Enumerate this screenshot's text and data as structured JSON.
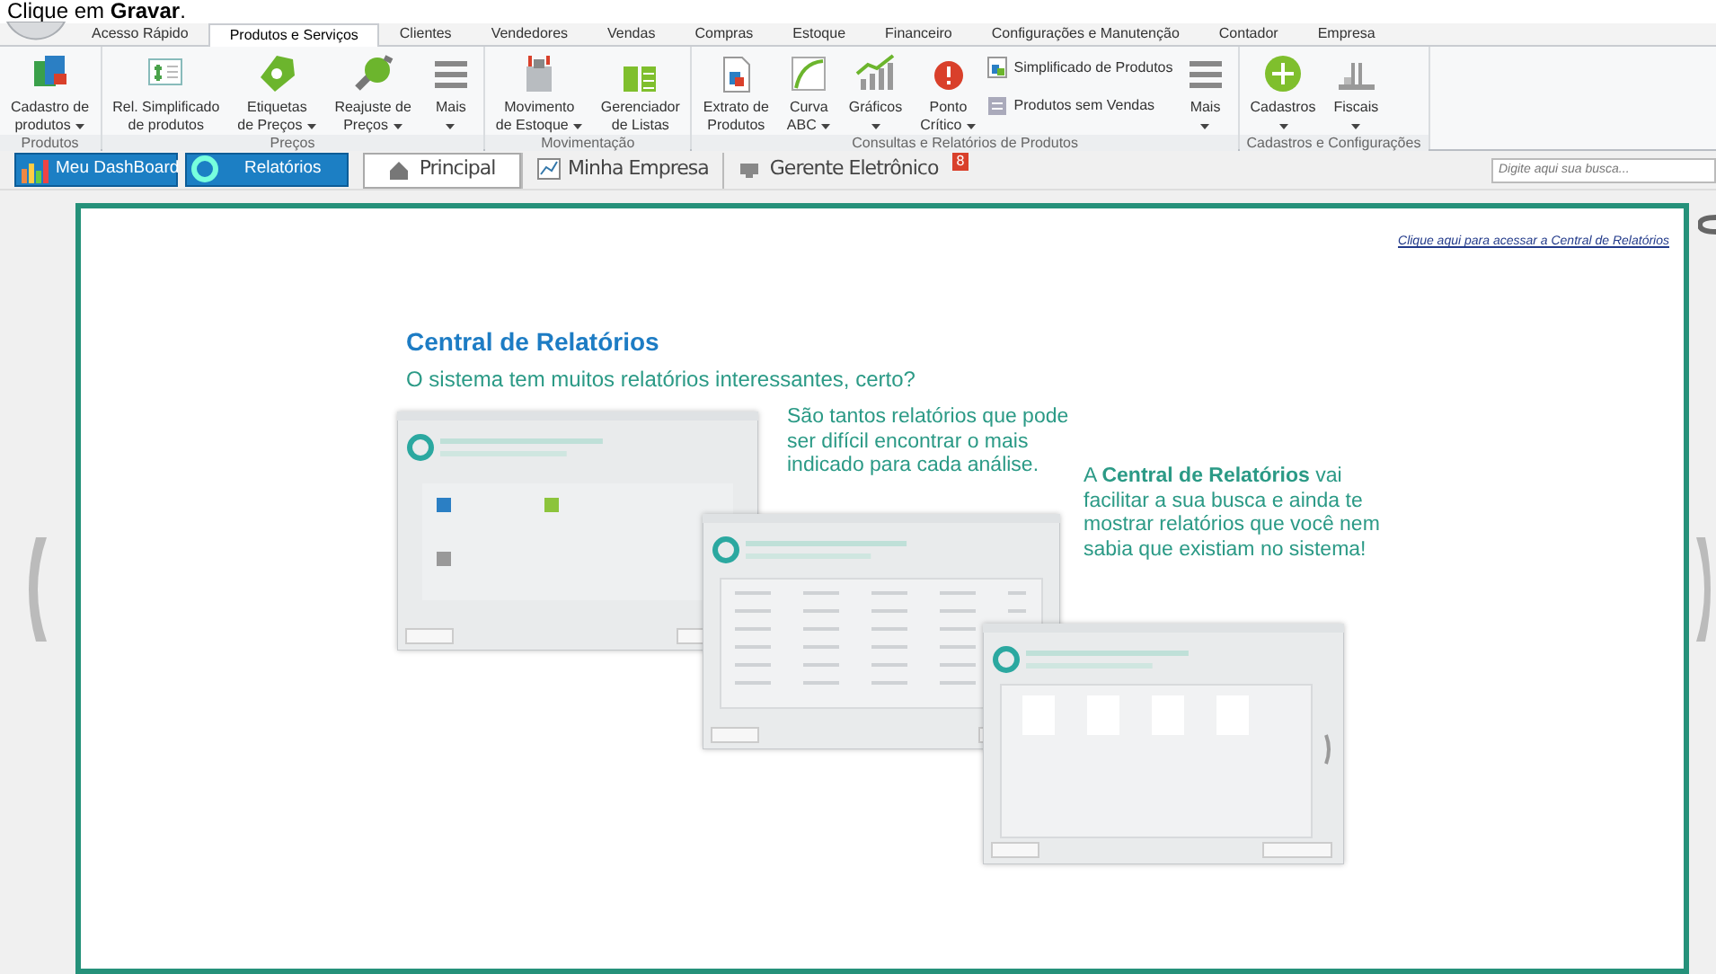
{
  "caption": "Clique em **Gravar**.",
  "menu_tabs": [
    {
      "label": "Acesso Rápido",
      "selected": false
    },
    {
      "label": "Produtos e Serviços",
      "selected": true
    },
    {
      "label": "Clientes",
      "selected": false
    },
    {
      "label": "Vendedores",
      "selected": false
    },
    {
      "label": "Vendas",
      "selected": false
    },
    {
      "label": "Compras",
      "selected": false
    },
    {
      "label": "Estoque",
      "selected": false
    },
    {
      "label": "Financeiro",
      "selected": false
    },
    {
      "label": "Configurações e Manutenção",
      "selected": false
    },
    {
      "label": "Contador",
      "selected": false
    },
    {
      "label": "Empresa",
      "selected": false
    }
  ],
  "ribbon_groups": [
    {
      "label": "Produtos",
      "items": [
        {
          "kind": "large",
          "lines": [
            "Cadastro de",
            "produtos"
          ],
          "dropdown": true
        }
      ]
    },
    {
      "label": "Preços",
      "items": [
        {
          "kind": "large",
          "lines": [
            "Rel. Simplificado",
            "de produtos"
          ],
          "dropdown": false
        },
        {
          "kind": "large",
          "lines": [
            "Etiquetas",
            "de Preços"
          ],
          "dropdown": true
        },
        {
          "kind": "large",
          "lines": [
            "Reajuste de",
            "Preços"
          ],
          "dropdown": true
        },
        {
          "kind": "large",
          "lines": [
            "Mais"
          ],
          "dropdown": true
        }
      ]
    },
    {
      "label": "Movimentação",
      "items": [
        {
          "kind": "large",
          "lines": [
            "Movimento",
            "de Estoque"
          ],
          "dropdown": true
        },
        {
          "kind": "large",
          "lines": [
            "Gerenciador",
            "de Listas"
          ],
          "dropdown": false
        }
      ]
    },
    {
      "label": "Consultas e Relatórios de Produtos",
      "items": [
        {
          "kind": "large",
          "lines": [
            "Extrato de",
            "Produtos"
          ],
          "dropdown": false
        },
        {
          "kind": "large",
          "lines": [
            "Curva",
            "ABC"
          ],
          "dropdown": true
        },
        {
          "kind": "large",
          "lines": [
            "Gráficos"
          ],
          "dropdown": true
        },
        {
          "kind": "large",
          "lines": [
            "Ponto",
            "Crítico"
          ],
          "dropdown": true
        },
        {
          "kind": "small",
          "lines": [
            "Simplificado de Produtos",
            "Produtos sem Vendas"
          ]
        },
        {
          "kind": "large",
          "lines": [
            "Mais"
          ],
          "dropdown": true
        }
      ]
    },
    {
      "label": "Cadastros e Configurações",
      "items": [
        {
          "kind": "large",
          "lines": [
            "Cadastros"
          ],
          "dropdown": true
        },
        {
          "kind": "large",
          "lines": [
            "Fiscais"
          ],
          "dropdown": true
        }
      ]
    }
  ],
  "quick_buttons": [
    {
      "label": "Meu DashBoard"
    },
    {
      "label": "Relatórios"
    }
  ],
  "view_tabs": [
    {
      "label": "Principal",
      "selected": true
    },
    {
      "label": "Minha Empresa",
      "selected": false
    },
    {
      "label": "Gerente Eletrônico",
      "selected": false,
      "badge": "8"
    }
  ],
  "search": {
    "placeholder": "Digite aqui sua busca..."
  },
  "slide": {
    "link": "Clique aqui para acessar a Central de Relatórios",
    "title": "Central de Relatórios",
    "subtitle": "O sistema tem muitos relatórios interessantes, certo?",
    "text_1": "São tantos relatórios que pode ser difícil encontrar o mais indicado para cada análise.",
    "text_2": "A **Central de Relatórios** vai facilitar a sua busca e ainda te mostrar relatórios que você nem sabia que existiam no sistema!"
  }
}
